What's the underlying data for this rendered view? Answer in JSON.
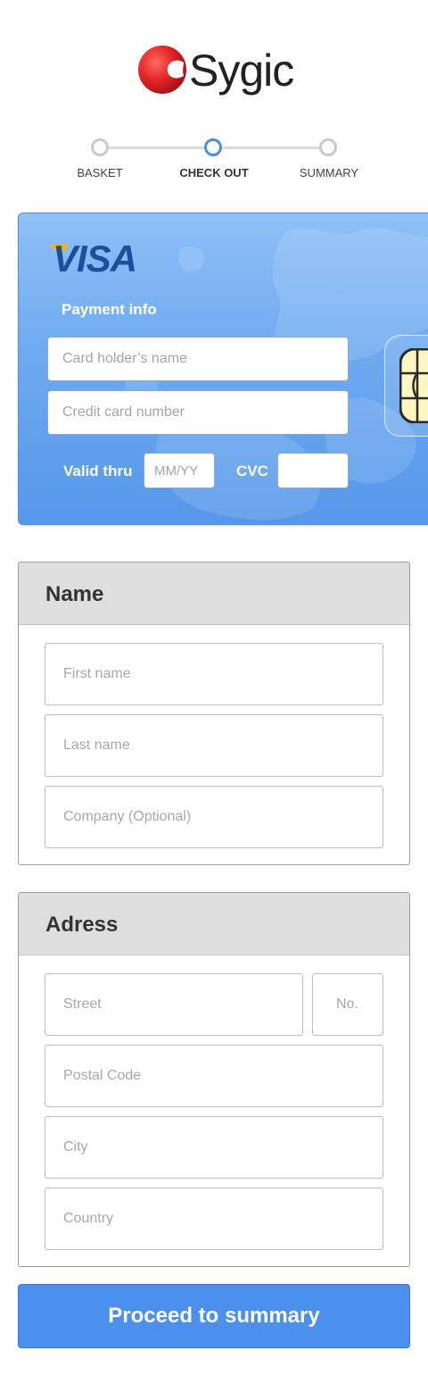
{
  "brand": {
    "name": "Sygic",
    "reg": "®",
    "accent": "#e52528"
  },
  "steps": [
    {
      "label": "BASKET",
      "active": false
    },
    {
      "label": "CHECK OUT",
      "active": true
    },
    {
      "label": "SUMMARY",
      "active": false
    }
  ],
  "card": {
    "brand_logo": "VISA",
    "title": "Payment info",
    "holder_placeholder": "Card holder’s name",
    "number_placeholder": "Credit card number",
    "valid_label": "Valid thru",
    "valid_placeholder": "MM/YY",
    "cvc_label": "CVC",
    "cvc_placeholder": "",
    "color": "#6eaaf0"
  },
  "name_section": {
    "title": "Name",
    "first_placeholder": "First name",
    "last_placeholder": "Last name",
    "company_placeholder": "Company (Optional)"
  },
  "address_section": {
    "title": "Adress",
    "street_placeholder": "Street",
    "number_placeholder": "No.",
    "postal_placeholder": "Postal Code",
    "city_placeholder": "City",
    "country_placeholder": "Country"
  },
  "actions": {
    "proceed_label": "Proceed to summary",
    "color": "#4a90ec"
  }
}
